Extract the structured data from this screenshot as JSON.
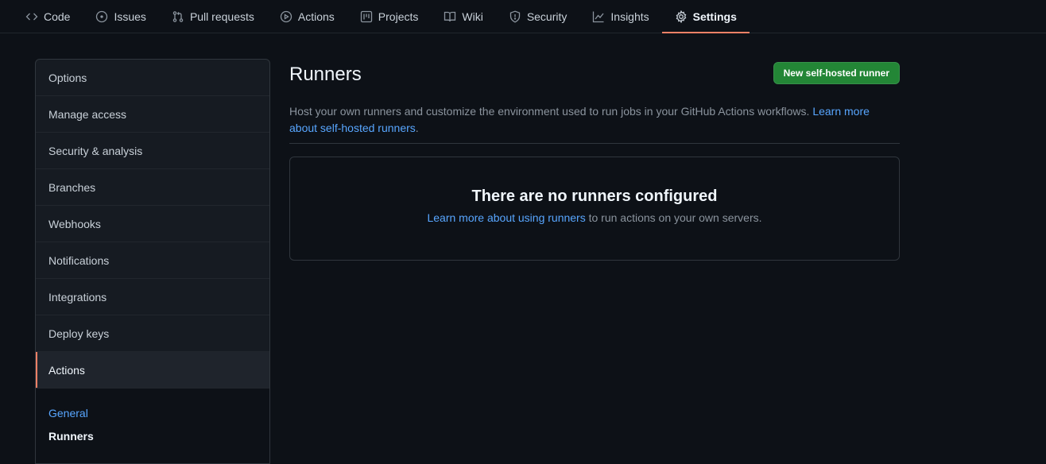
{
  "nav": {
    "tabs": [
      {
        "label": "Code",
        "icon": "code-icon"
      },
      {
        "label": "Issues",
        "icon": "issue-opened-icon"
      },
      {
        "label": "Pull requests",
        "icon": "git-pull-request-icon"
      },
      {
        "label": "Actions",
        "icon": "play-icon"
      },
      {
        "label": "Projects",
        "icon": "project-icon"
      },
      {
        "label": "Wiki",
        "icon": "book-icon"
      },
      {
        "label": "Security",
        "icon": "shield-icon"
      },
      {
        "label": "Insights",
        "icon": "graph-icon"
      },
      {
        "label": "Settings",
        "icon": "gear-icon",
        "active": true
      }
    ]
  },
  "sidebar": {
    "items": [
      {
        "label": "Options"
      },
      {
        "label": "Manage access"
      },
      {
        "label": "Security & analysis"
      },
      {
        "label": "Branches"
      },
      {
        "label": "Webhooks"
      },
      {
        "label": "Notifications"
      },
      {
        "label": "Integrations"
      },
      {
        "label": "Deploy keys"
      },
      {
        "label": "Actions",
        "selected": true
      }
    ],
    "sub_items": [
      {
        "label": "General"
      },
      {
        "label": "Runners",
        "current": true
      }
    ]
  },
  "main": {
    "title": "Runners",
    "new_runner_button": "New self-hosted runner",
    "description": "Host your own runners and customize the environment used to run jobs in your GitHub Actions workflows.",
    "description_link": "Learn more about self-hosted runners",
    "description_end": ".",
    "blank_title": "There are no runners configured",
    "blank_link": "Learn more about using runners",
    "blank_rest": " to run actions on your own servers."
  },
  "colors": {
    "background": "#0d1117",
    "accent_underline": "#f78166",
    "primary_button": "#238636",
    "link": "#58a6ff"
  }
}
